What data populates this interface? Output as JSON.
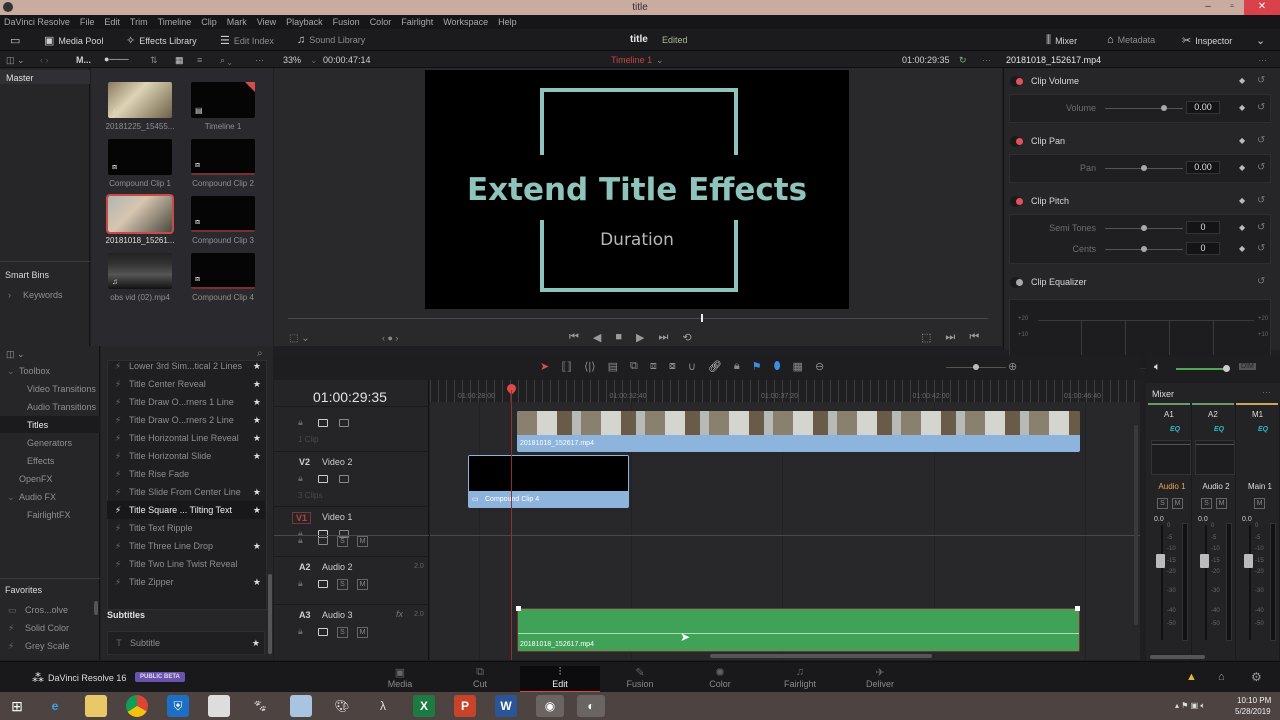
{
  "window": {
    "title": "title",
    "minimize": "–",
    "maximize": "▫",
    "close": "✕"
  },
  "menu": [
    "DaVinci Resolve",
    "File",
    "Edit",
    "Trim",
    "Timeline",
    "Clip",
    "Mark",
    "View",
    "Playback",
    "Fusion",
    "Color",
    "Fairlight",
    "Workspace",
    "Help"
  ],
  "toolbar": {
    "media_pool": "Media Pool",
    "effects_library": "Effects Library",
    "edit_index": "Edit Index",
    "sound_library": "Sound Library",
    "project_title": "title",
    "project_status": "Edited",
    "mixer": "Mixer",
    "metadata": "Metadata",
    "inspector": "Inspector"
  },
  "subbar": {
    "bin_short": "M...",
    "zoom": "33%",
    "source_timecode": "00:00:47:14",
    "timeline_name": "Timeline 1",
    "record_timecode": "01:00:29:35",
    "inspector_clip": "20181018_152617.mp4"
  },
  "bins": {
    "master": "Master",
    "smart_bins": "Smart Bins",
    "keywords": "Keywords"
  },
  "media_pool": [
    {
      "label": "20181225_15455...",
      "kind": "video-audio"
    },
    {
      "label": "Timeline 1",
      "kind": "timeline"
    },
    {
      "label": "Compound Clip 1",
      "kind": "compound"
    },
    {
      "label": "Compound Clip 2",
      "kind": "compound"
    },
    {
      "label": "20181018_15261...",
      "kind": "video",
      "selected": true
    },
    {
      "label": "Compound Clip 3",
      "kind": "compound"
    },
    {
      "label": "obs vid (02).mp4",
      "kind": "audio"
    },
    {
      "label": "Compound Clip 4",
      "kind": "compound"
    }
  ],
  "viewer": {
    "title": "Extend Title Effects",
    "subtitle": "Duration",
    "accent": "#8fc4bc",
    "playhead_position": 0.59
  },
  "inspector": {
    "sections": [
      {
        "name": "Clip Volume",
        "enabled": true,
        "params": [
          {
            "label": "Volume",
            "value": "0.00",
            "position": 0.75
          }
        ]
      },
      {
        "name": "Clip Pan",
        "enabled": true,
        "params": [
          {
            "label": "Pan",
            "value": "0.00",
            "position": 0.5
          }
        ]
      },
      {
        "name": "Clip Pitch",
        "enabled": true,
        "params": [
          {
            "label": "Semi Tones",
            "value": "0",
            "position": 0.5
          },
          {
            "label": "Cents",
            "value": "0",
            "position": 0.5
          }
        ]
      },
      {
        "name": "Clip Equalizer",
        "enabled": false,
        "params": []
      }
    ],
    "eq_ticks": [
      "+20",
      "+10"
    ]
  },
  "effects": {
    "sidebar": [
      {
        "label": "Toolbox",
        "level": 0,
        "expanded": true
      },
      {
        "label": "Video Transitions",
        "level": 1
      },
      {
        "label": "Audio Transitions",
        "level": 1
      },
      {
        "label": "Titles",
        "level": 1,
        "selected": true
      },
      {
        "label": "Generators",
        "level": 1
      },
      {
        "label": "Effects",
        "level": 1
      },
      {
        "label": "OpenFX",
        "level": 0
      },
      {
        "label": "Audio FX",
        "level": 0,
        "expanded": true
      },
      {
        "label": "FairlightFX",
        "level": 1
      }
    ],
    "favorites_label": "Favorites",
    "favorites": [
      "Cros...olve",
      "Solid Color",
      "Grey Scale"
    ],
    "titles": [
      {
        "label": "Lower 3rd Sim...tical 2 Lines",
        "fav": true
      },
      {
        "label": "Title Center Reveal",
        "fav": true
      },
      {
        "label": "Title Draw O...rners 1 Line",
        "fav": true
      },
      {
        "label": "Title Draw O...rners 2 Line",
        "fav": true
      },
      {
        "label": "Title Horizontal Line Reveal",
        "fav": true
      },
      {
        "label": "Title Horizontal Slide",
        "fav": true
      },
      {
        "label": "Title Rise Fade",
        "fav": false
      },
      {
        "label": "Title Slide From Center Line",
        "fav": true
      },
      {
        "label": "Title Square ... Tilting Text",
        "fav": true,
        "selected": true
      },
      {
        "label": "Title Text Ripple",
        "fav": false
      },
      {
        "label": "Title Three Line Drop",
        "fav": true
      },
      {
        "label": "Title Two Line Twist Reveal",
        "fav": false
      },
      {
        "label": "Title Zipper",
        "fav": true
      }
    ],
    "subtitles_label": "Subtitles",
    "subtitle_item": "Subtitle"
  },
  "timeline": {
    "timecode": "01:00:29:35",
    "ruler": [
      "01:00:28:00",
      "01:00:32:40",
      "01:00:37:20",
      "01:00:42:00",
      "01:00:46:40"
    ],
    "tracks": [
      {
        "id": "",
        "name": "",
        "info": "1 Clip"
      },
      {
        "id": "V2",
        "name": "Video 2",
        "info": "3 Clips"
      },
      {
        "id": "V1",
        "name": "Video 1",
        "info": ""
      },
      {
        "id": "A2",
        "name": "Audio 2",
        "channels": "2.0"
      },
      {
        "id": "A3",
        "name": "Audio 3",
        "channels": "2.0",
        "fx": "fx"
      }
    ],
    "clips": {
      "v3": "20181018_152617.mp4",
      "v2": "Compound Clip 4",
      "a3": "20181018_152617.mp4"
    },
    "solo": "S",
    "mute": "M"
  },
  "mixer": {
    "title": "Mixer",
    "dim": "DIM",
    "channels": [
      {
        "id": "A1",
        "name": "Audio 1",
        "level": "0.0",
        "active": true
      },
      {
        "id": "A2",
        "name": "Audio 2",
        "level": "0.0"
      },
      {
        "id": "M1",
        "name": "Main 1",
        "level": "0.0"
      }
    ],
    "eq": "EQ",
    "scale": [
      "0",
      "-5",
      "-10",
      "-15",
      "-20",
      "-30",
      "-40",
      "-50"
    ],
    "monitor_volume": 0.9
  },
  "pages": [
    "Media",
    "Cut",
    "Edit",
    "Fusion",
    "Color",
    "Fairlight",
    "Deliver"
  ],
  "active_page": "Edit",
  "brand": {
    "name": "DaVinci Resolve 16",
    "badge": "PUBLIC BETA"
  },
  "taskbar": {
    "time": "10:10 PM",
    "date": "5/28/2019"
  }
}
